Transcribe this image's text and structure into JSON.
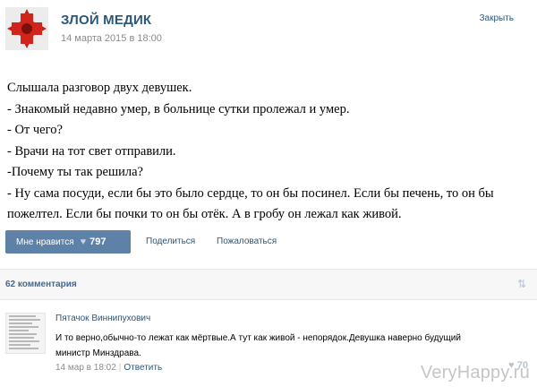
{
  "post": {
    "author": "ЗЛОЙ МЕДИК",
    "date": "14 марта 2015 в 18:00",
    "close_label": "Закрыть",
    "text_lines": [
      "Слышала разговор двух девушек.",
      "- Знакомый недавно умер, в больнице сутки пролежал и умер.",
      "- От чего?",
      "- Врачи на тот свет отправили.",
      "-Почему ты так решила?",
      "- Ну сама посуди, если бы это было сердце, то он бы посинел. Если бы печень, то он бы пожелтел. Если бы почки то он бы отёк. А в гробу он лежал как живой."
    ]
  },
  "actions": {
    "like_label": "Мне нравится",
    "like_icon": "heart-icon",
    "like_count": "797",
    "share_label": "Поделиться",
    "report_label": "Пожаловаться"
  },
  "comments": {
    "count_label": "62 комментария",
    "sort_icon": "sort-arrows-icon",
    "items": [
      {
        "author": "Пятачок Виннипухович",
        "text": "И то верно,обычно-то лежат как мёртвые.А тут как живой - непорядок.Девушка наверно будущий министр Минздрава.",
        "date": "14 мар в 18:02",
        "reply_label": "Ответить",
        "likes": "70"
      }
    ]
  },
  "watermark": "VeryHappy.ru",
  "colors": {
    "link": "#2b587a",
    "like_button": "#5e81a8",
    "avatar_cross": "#d0241c"
  }
}
